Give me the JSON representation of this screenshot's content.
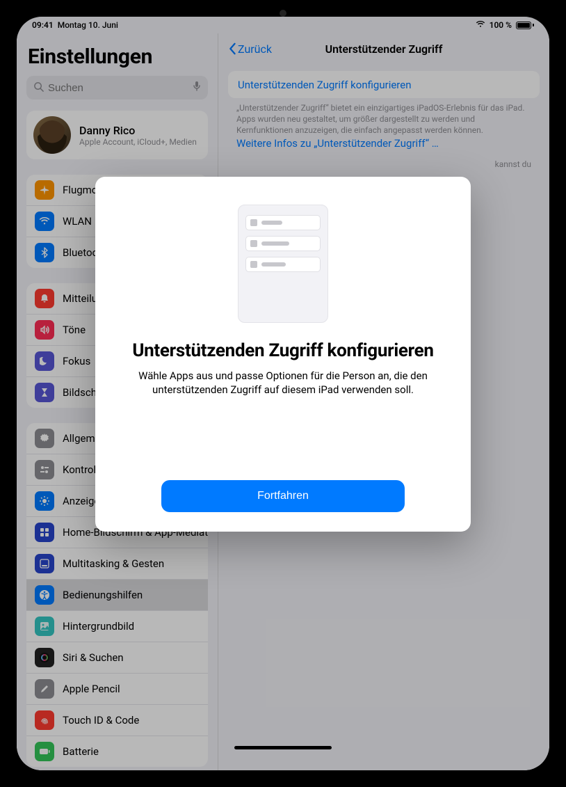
{
  "status": {
    "time": "09:41",
    "date": "Montag 10. Juni",
    "battery": "100 %"
  },
  "sidebar": {
    "title": "Einstellungen",
    "search_placeholder": "Suchen",
    "account": {
      "name": "Danny Rico",
      "subtitle": "Apple Account, iCloud+, Medien"
    },
    "groups": [
      {
        "items": [
          {
            "icon": "airplane-icon",
            "color": "#ff9500",
            "label": "Flugmodus"
          },
          {
            "icon": "wifi-icon",
            "color": "#007aff",
            "label": "WLAN"
          },
          {
            "icon": "bluetooth-icon",
            "color": "#007aff",
            "label": "Bluetooth"
          }
        ]
      },
      {
        "items": [
          {
            "icon": "bell-icon",
            "color": "#ff3b30",
            "label": "Mitteilungen"
          },
          {
            "icon": "speaker-icon",
            "color": "#ff2d55",
            "label": "Töne"
          },
          {
            "icon": "moon-icon",
            "color": "#5856d6",
            "label": "Fokus"
          },
          {
            "icon": "hourglass-icon",
            "color": "#5856d6",
            "label": "Bildschirmzeit"
          }
        ]
      },
      {
        "items": [
          {
            "icon": "gear-icon",
            "color": "#8e8e93",
            "label": "Allgemein"
          },
          {
            "icon": "switches-icon",
            "color": "#8e8e93",
            "label": "Kontrollzentrum"
          },
          {
            "icon": "sun-icon",
            "color": "#007aff",
            "label": "Anzeige & Helligkeit"
          },
          {
            "icon": "grid-icon",
            "color": "#2845cc",
            "label": "Home-Bildschirm & App-Mediathek"
          },
          {
            "icon": "dock-icon",
            "color": "#2845cc",
            "label": "Multitasking & Gesten"
          },
          {
            "icon": "accessibility-icon",
            "color": "#007aff",
            "label": "Bedienungshilfen",
            "selected": true
          },
          {
            "icon": "wallpaper-icon",
            "color": "#34c7c2",
            "label": "Hintergrundbild"
          },
          {
            "icon": "siri-icon",
            "color": "#222",
            "label": "Siri & Suchen"
          },
          {
            "icon": "pencil-icon",
            "color": "#8e8e93",
            "label": "Apple Pencil"
          },
          {
            "icon": "touchid-icon",
            "color": "#ff3b30",
            "label": "Touch ID & Code"
          },
          {
            "icon": "battery-icon",
            "color": "#34c759",
            "label": "Batterie"
          }
        ]
      }
    ]
  },
  "detail": {
    "back": "Zurück",
    "title": "Unterstützender Zugriff",
    "configure_link": "Unterstützenden Zugriff konfigurieren",
    "description": "„Unterstützender Zugriff“ bietet ein einzigartiges iPadOS-Erlebnis für das iPad. Apps wurden neu gestaltet, um größer dargestellt zu werden und Kernfunktionen anzuzeigen, die einfach angepasst werden können.",
    "more_link": "Weitere Infos zu „Unterstützender Zugriff“ …",
    "extra": "kannst du"
  },
  "modal": {
    "title": "Unterstützenden Zugriff konfigurieren",
    "body": "Wähle Apps aus und passe Optionen für die Person an, die den unterstützenden Zugriff auf diesem iPad verwenden soll.",
    "continue": "Fortfahren"
  }
}
